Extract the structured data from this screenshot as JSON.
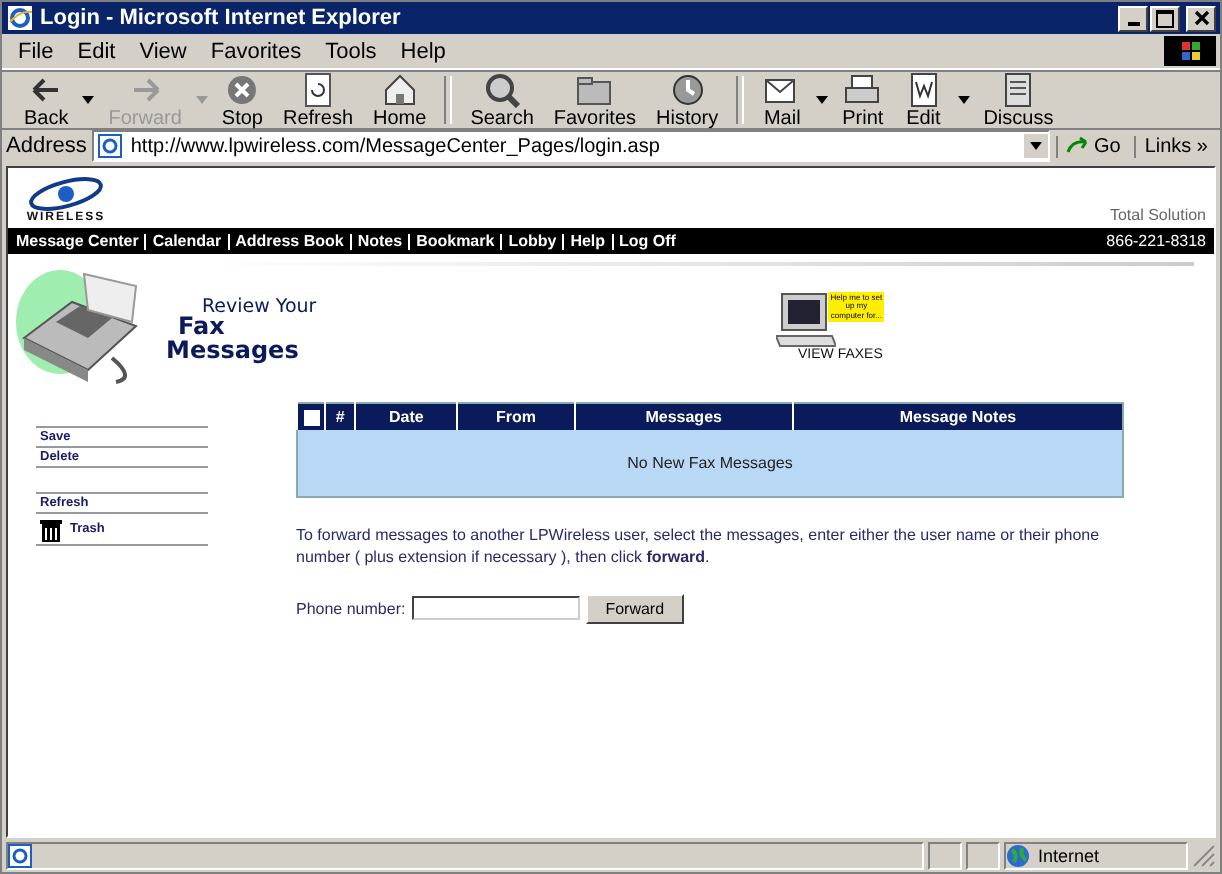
{
  "window": {
    "title": "Login - Microsoft Internet Explorer"
  },
  "menu": [
    "File",
    "Edit",
    "View",
    "Favorites",
    "Tools",
    "Help"
  ],
  "toolbar": [
    {
      "kind": "back",
      "label": "Back",
      "disabled": false,
      "dropdown": true
    },
    {
      "kind": "forward",
      "label": "Forward",
      "disabled": true,
      "dropdown": true
    },
    {
      "kind": "stop",
      "label": "Stop",
      "disabled": false,
      "dropdown": false
    },
    {
      "kind": "refresh",
      "label": "Refresh",
      "disabled": false,
      "dropdown": false
    },
    {
      "kind": "home",
      "label": "Home",
      "disabled": false,
      "dropdown": false
    },
    {
      "kind": "sep"
    },
    {
      "kind": "search",
      "label": "Search",
      "disabled": false,
      "dropdown": false
    },
    {
      "kind": "favorites",
      "label": "Favorites",
      "disabled": false,
      "dropdown": false
    },
    {
      "kind": "history",
      "label": "History",
      "disabled": false,
      "dropdown": false
    },
    {
      "kind": "sep"
    },
    {
      "kind": "mail",
      "label": "Mail",
      "disabled": false,
      "dropdown": true
    },
    {
      "kind": "print",
      "label": "Print",
      "disabled": false,
      "dropdown": false
    },
    {
      "kind": "edit",
      "label": "Edit",
      "disabled": false,
      "dropdown": true
    },
    {
      "kind": "discuss",
      "label": "Discuss",
      "disabled": false,
      "dropdown": false
    }
  ],
  "address": {
    "label": "Address",
    "value": "http://www.lpwireless.com/MessageCenter_Pages/login.asp",
    "go": "Go",
    "links": "Links",
    "links_chevron": "»"
  },
  "page": {
    "logo_text": "WIRELESS",
    "tagline": "Total Solution",
    "nav": [
      "Message Center",
      "Calendar",
      "Address Book",
      "Notes",
      "Bookmark",
      "Lobby",
      "Help",
      "Log Off"
    ],
    "phone": "866-221-8318",
    "heading": [
      "Review Your",
      "Fax",
      "Messages"
    ],
    "view_faxes": {
      "sticker": "Help me to set up my computer for...",
      "label": "VIEW FAXES"
    },
    "sidebar": [
      {
        "kind": "link",
        "label": "Save"
      },
      {
        "kind": "link",
        "label": "Delete"
      },
      {
        "kind": "gap"
      },
      {
        "kind": "link",
        "label": "Refresh"
      },
      {
        "kind": "trash",
        "label": "Trash"
      }
    ],
    "table": {
      "select_all_checked": false,
      "columns": [
        "#",
        "Date",
        "From",
        "Messages",
        "Message Notes"
      ],
      "empty": "No New Fax Messages"
    },
    "instructions": "To forward messages to another LPWireless user, select the messages, enter either the user name or their phone number ( plus extension if necessary ), then click **forward**.",
    "phone_field": {
      "label": "Phone number:"
    },
    "forward_button": "Forward"
  },
  "status_bar": {
    "zone": "Internet"
  }
}
